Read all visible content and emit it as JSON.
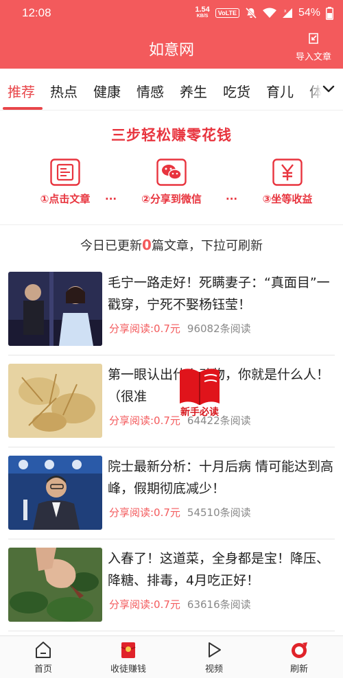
{
  "status_bar": {
    "time": "12:08",
    "net_speed_value": "1.54",
    "net_speed_unit": "KB/S",
    "volte": "VoLTE",
    "battery": "54%"
  },
  "header": {
    "title": "如意网",
    "import_label": "导入文章"
  },
  "tabs": [
    "推荐",
    "热点",
    "健康",
    "情感",
    "养生",
    "吃货",
    "育儿",
    "体"
  ],
  "active_tab": 0,
  "promo": {
    "title": "三步轻松赚零花钱",
    "steps": [
      "①点击文章",
      "②分享到微信",
      "③坐等收益"
    ],
    "dots": "···"
  },
  "notice": {
    "prefix": "今日已更新",
    "count": "0",
    "suffix": "篇文章，下拉可刷新"
  },
  "articles": [
    {
      "title": "毛宁一路走好！死瞒妻子：“真面目”一戳穿，宁死不娶杨钰莹！",
      "pay": "分享阅读:0.7元",
      "reads": "96082条阅读"
    },
    {
      "title": "第一眼认出什么动物，你就是什么人！（很准",
      "pay": "分享阅读:0.7元",
      "reads": "64422条阅读"
    },
    {
      "title": "院士最新分析：十月后病 情可能达到高峰，假期彻底减少！",
      "pay": "分享阅读:0.7元",
      "reads": "54510条阅读"
    },
    {
      "title": "入春了！这道菜，全身都是宝！降压、降糖、排毒，4月吃正好！",
      "pay": "分享阅读:0.7元",
      "reads": "63616条阅读"
    }
  ],
  "badge": {
    "label": "新手必读"
  },
  "bottom_nav": [
    "首页",
    "收徒赚钱",
    "视频",
    "刷新"
  ],
  "colors": {
    "brand": "#f35a5c",
    "accent": "#e8343e"
  }
}
